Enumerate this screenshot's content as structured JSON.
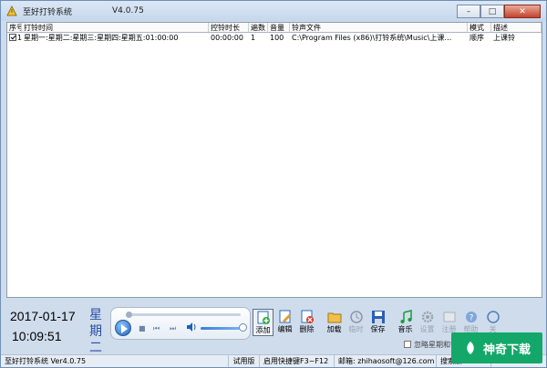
{
  "window": {
    "title": "至好打铃系统",
    "version": "V4.0.75",
    "buttons": {
      "minimize": "–",
      "maximize": "□",
      "close": "✕"
    }
  },
  "list": {
    "headers": [
      "序号",
      "打铃时间",
      "控铃时长",
      "遍数",
      "音量",
      "铃声文件",
      "模式",
      "描述"
    ],
    "rows": [
      {
        "no": "1",
        "time": "星期一:星期二:星期三:星期四:星期五:01:00:00",
        "duration": "00:00:00",
        "repeat": "1",
        "volume": "100",
        "file": "C:\\Program Files (x86)\\打铃系统\\Music\\上课…",
        "mode": "顺序",
        "desc": "上课铃"
      }
    ]
  },
  "clock": {
    "date": "2017-01-17",
    "time": "10:09:51",
    "weekday_line1": "星期",
    "weekday_line2": "二"
  },
  "toolbar": {
    "items": [
      {
        "label": "添加",
        "icon": "add-icon"
      },
      {
        "label": "编辑",
        "icon": "edit-icon"
      },
      {
        "label": "删除",
        "icon": "delete-icon"
      },
      {
        "label": "加载",
        "icon": "folder-icon"
      },
      {
        "label": "临时",
        "icon": "temporary-icon"
      },
      {
        "label": "保存",
        "icon": "save-icon"
      },
      {
        "label": "音乐",
        "icon": "music-icon"
      },
      {
        "label": "设置",
        "icon": "gear-icon"
      },
      {
        "label": "注册",
        "icon": "register-icon"
      },
      {
        "label": "帮助",
        "icon": "help-icon"
      },
      {
        "label": "关",
        "icon": "close-icon"
      }
    ]
  },
  "options": {
    "checkbox_label": "忽略星期和钟"
  },
  "statusbar": {
    "app": "至好打铃系统 Ver4.0.75",
    "edition": "试用版",
    "hotkey": "启用快捷键F3~F12",
    "email": "邮箱: zhihaosoft@126.com",
    "extra": "搜索加"
  },
  "watermark": {
    "text": "神奇下载"
  },
  "colors": {
    "weekday": "#2b4ea8",
    "watermark_bg": "#13a869"
  }
}
